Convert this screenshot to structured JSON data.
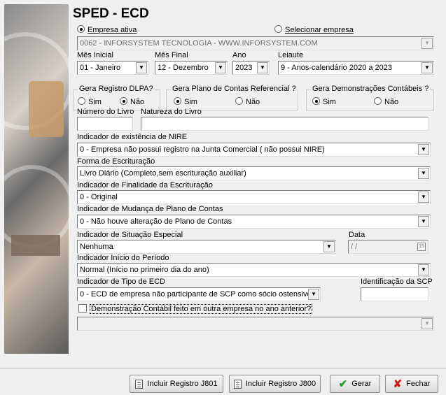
{
  "title": "SPED - ECD",
  "empresa": {
    "radio_ativa": "Empresa ativa",
    "radio_selecionar": "Selecionar empresa",
    "selected": "0062 - INFORSYSTEM TECNOLOGIA - WWW.INFORSYSTEM.COM"
  },
  "periodo": {
    "mes_inicial_label": "Mês Inicial",
    "mes_inicial_value": "01 - Janeiro",
    "mes_final_label": "Mês Final",
    "mes_final_value": "12 - Dezembro",
    "ano_label": "Ano",
    "ano_value": "2023",
    "leiaute_label": "Leiaute",
    "leiaute_value": "9 - Anos-calendário 2020 a 2023"
  },
  "groups": {
    "dlpa_title": "Gera Registro DLPA?",
    "plano_title": "Gera Plano de Contas Referencial ?",
    "demo_title": "Gera Demonstrações Contábeis ?",
    "sim": "Sim",
    "nao": "Não"
  },
  "livro": {
    "numero_label": "Número do Livro",
    "numero_value": "",
    "natureza_label": "Natureza do Livro",
    "natureza_value": ""
  },
  "nire": {
    "label": "Indicador de existência de NIRE",
    "value": "0 - Empresa não possui registro na Junta Comercial ( não possui NIRE)"
  },
  "forma": {
    "label": "Forma de Escrituração",
    "value": "Livro Diário (Completo,sem escrituração auxiliar)"
  },
  "finalidade": {
    "label": "Indicador de Finalidade da Escrituração",
    "value": "0 - Original"
  },
  "mudanca": {
    "label": "Indicador de Mudança de Plano de Contas",
    "value": "0 - Não houve alteração de Plano de Contas"
  },
  "situacao": {
    "label": "Indicador de Situação Especial",
    "value": "Nenhuma",
    "data_label": "Data",
    "data_value": " /  /"
  },
  "inicio": {
    "label": "Indicador Início do Período",
    "value": "Normal (Início no primeiro dia do ano)"
  },
  "tipo_ecd": {
    "label": "Indicador de Tipo de ECD",
    "value": "0 - ECD de empresa não participante de SCP como sócio ostensivo",
    "scp_label": "Identificação da SCP",
    "scp_value": ""
  },
  "demonstracao": {
    "check_label": "Demonstração Contábil feito em outra empresa no ano anterior?",
    "select_value": ""
  },
  "buttons": {
    "j801": "Incluir Registro J801",
    "j800": "Incluir Registro J800",
    "gerar": "Gerar",
    "fechar": "Fechar"
  }
}
